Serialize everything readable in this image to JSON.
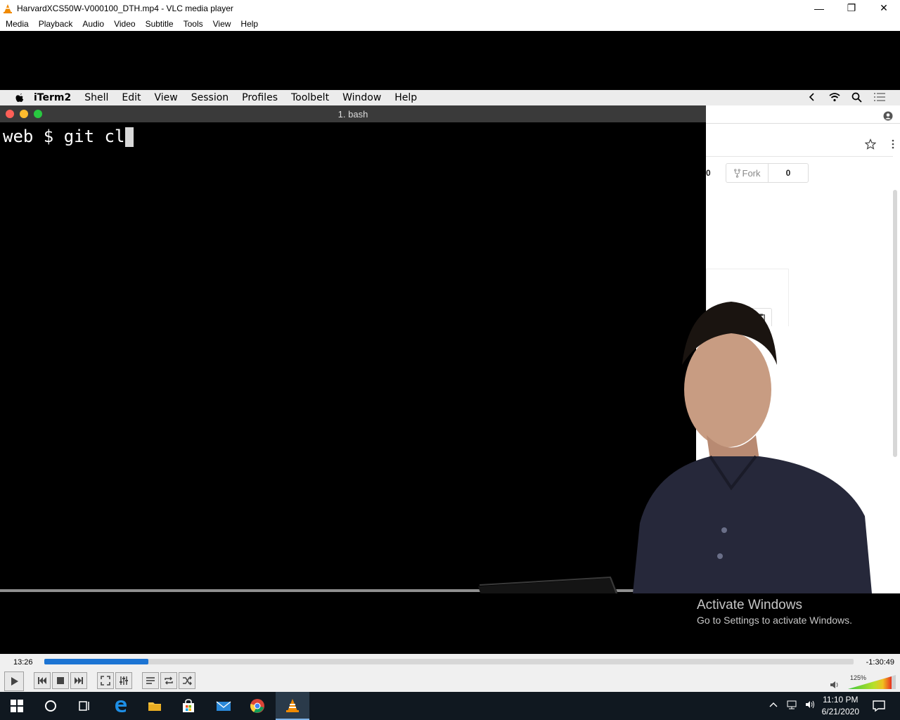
{
  "window": {
    "title": "HarvardXCS50W-V000100_DTH.mp4 - VLC media player"
  },
  "vlc_menu": [
    "Media",
    "Playback",
    "Audio",
    "Video",
    "Subtitle",
    "Tools",
    "View",
    "Help"
  ],
  "mac_menu": [
    "iTerm2",
    "Shell",
    "Edit",
    "View",
    "Session",
    "Profiles",
    "Toolbelt",
    "Window",
    "Help"
  ],
  "terminal": {
    "tab_title": "1. bash",
    "prompt_line": "web $ git cl"
  },
  "browser": {
    "fork_label": "Fork",
    "fork_count": "0",
    "partial_count": "0"
  },
  "watermark": {
    "line1": "Activate Windows",
    "line2": "Go to Settings to activate Windows."
  },
  "player": {
    "elapsed": "13:26",
    "remaining": "-1:30:49",
    "progress_fraction": 0.1286,
    "volume": "125%"
  },
  "taskbar": {
    "time": "11:10 PM",
    "date": "6/21/2020"
  },
  "colors": {
    "seek_fill": "#1c74d3",
    "mac_close": "#fe5f57",
    "mac_min": "#febc2e",
    "mac_max": "#28c840"
  }
}
